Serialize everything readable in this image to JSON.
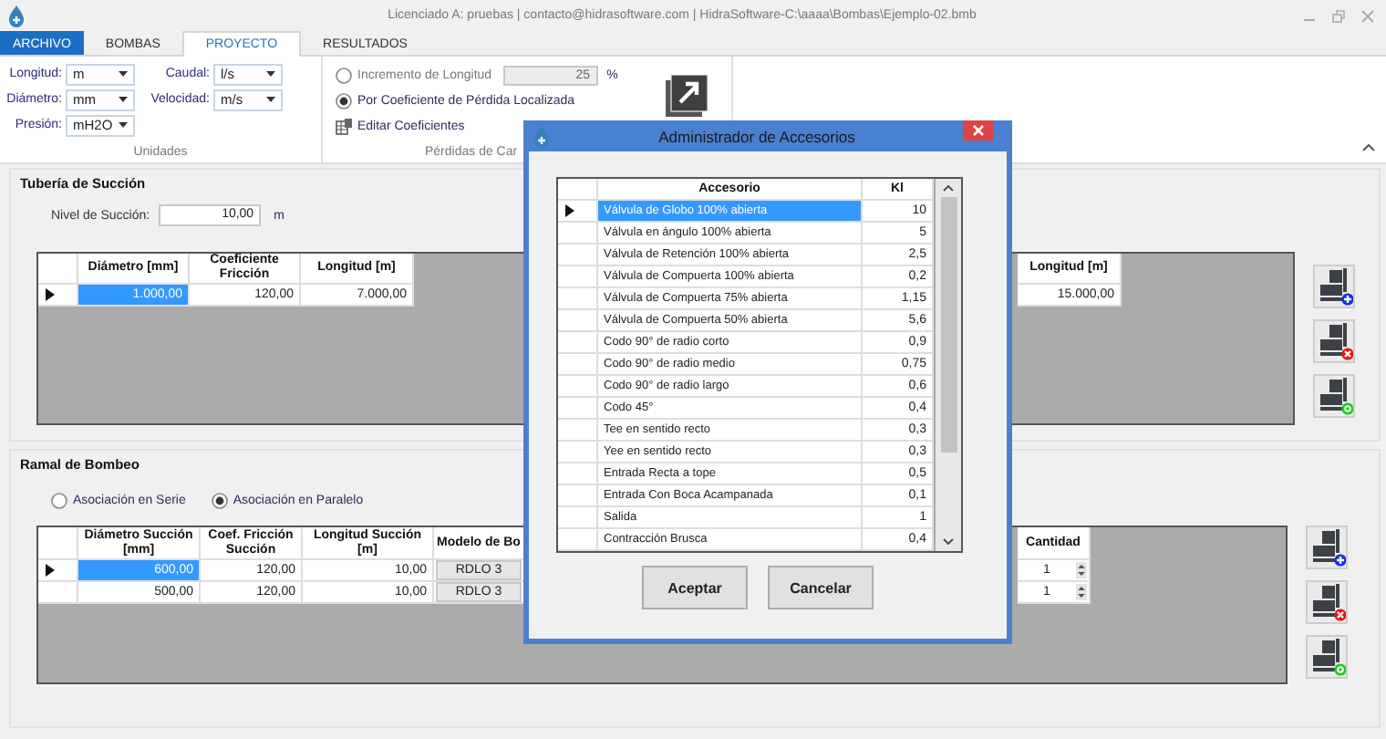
{
  "window": {
    "title": "Licenciado A: pruebas | contacto@hidrasoftware.com | HidraSoftware-C:\\aaaa\\Bombas\\Ejemplo-02.bmb"
  },
  "tabs": [
    {
      "label": "ARCHIVO",
      "kind": "file",
      "selected": false
    },
    {
      "label": "BOMBAS",
      "kind": "tab",
      "selected": false
    },
    {
      "label": "PROYECTO",
      "kind": "tab",
      "selected": true
    },
    {
      "label": "RESULTADOS",
      "kind": "tab",
      "selected": false
    }
  ],
  "units": {
    "label": "Unidades",
    "columns": [
      {
        "fields": [
          {
            "label": "Longitud:",
            "value": "m"
          },
          {
            "label": "Diámetro:",
            "value": "mm"
          },
          {
            "label": "Presión:",
            "value": "mH2O"
          }
        ]
      },
      {
        "fields": [
          {
            "label": "Caudal:",
            "value": "l/s"
          },
          {
            "label": "Velocidad:",
            "value": "m/s"
          }
        ]
      }
    ]
  },
  "losses": {
    "label": "Pérdidas de Car",
    "options": [
      {
        "label": "Incremento de Longitud",
        "selected": false,
        "disabled": true,
        "value": "25",
        "unit": "%"
      },
      {
        "label": "Por Coeficiente de Pérdida Localizada",
        "selected": true,
        "disabled": false
      }
    ],
    "link": "Editar Coeficientes"
  },
  "suction": {
    "title": "Tubería de Succión",
    "suction_level": {
      "label": "Nivel de Succión:",
      "value": "10,00",
      "unit": "m"
    },
    "columns": [
      "Diámetro [mm]",
      "Coeficiente Fricción",
      "Longitud [m]"
    ],
    "rows": [
      {
        "selected": true,
        "cells": [
          "1.000,00",
          "120,00",
          "7.000,00"
        ],
        "end_cell": "15.000,00"
      }
    ],
    "end_column": "Longitud [m]"
  },
  "pump_branch": {
    "title": "Ramal de Bombeo",
    "association": [
      {
        "label": "Asociación en Serie",
        "selected": false
      },
      {
        "label": "Asociación en Paralelo",
        "selected": true
      }
    ],
    "columns": [
      "Diámetro Succión [mm]",
      "Coef. Fricción Succión",
      "Longitud Succión [m]",
      "Modelo de Bo"
    ],
    "rows": [
      {
        "selected": true,
        "cells": [
          "600,00",
          "120,00",
          "10,00"
        ],
        "model": "RDLO 3",
        "quantity": "1"
      },
      {
        "selected": false,
        "cells": [
          "500,00",
          "120,00",
          "10,00"
        ],
        "model": "RDLO 3",
        "quantity": "1"
      }
    ],
    "end_column": "Cantidad"
  },
  "dialog": {
    "title": "Administrador de Accesorios",
    "columns": [
      "Accesorio",
      "Kl"
    ],
    "rows": [
      {
        "name": "Válvula de Globo 100% abierta",
        "kl": "10",
        "selected": true
      },
      {
        "name": "Válvula en ángulo 100% abierta",
        "kl": "5",
        "selected": false
      },
      {
        "name": "Válvula de Retención 100% abierta",
        "kl": "2,5",
        "selected": false
      },
      {
        "name": "Válvula de Compuerta 100% abierta",
        "kl": "0,2",
        "selected": false
      },
      {
        "name": "Válvula de Compuerta 75% abierta",
        "kl": "1,15",
        "selected": false
      },
      {
        "name": "Válvula de Compuerta 50% abierta",
        "kl": "5,6",
        "selected": false
      },
      {
        "name": "Codo 90° de radio corto",
        "kl": "0,9",
        "selected": false
      },
      {
        "name": "Codo 90° de radio medio",
        "kl": "0,75",
        "selected": false
      },
      {
        "name": "Codo 90° de radio largo",
        "kl": "0,6",
        "selected": false
      },
      {
        "name": "Codo 45°",
        "kl": "0,4",
        "selected": false
      },
      {
        "name": "Tee en sentido recto",
        "kl": "0,3",
        "selected": false
      },
      {
        "name": "Yee en sentido recto",
        "kl": "0,3",
        "selected": false
      },
      {
        "name": "Entrada Recta a tope",
        "kl": "0,5",
        "selected": false
      },
      {
        "name": "Entrada Con Boca Acampanada",
        "kl": "0,1",
        "selected": false
      },
      {
        "name": "Salida",
        "kl": "1",
        "selected": false
      },
      {
        "name": "Contracción Brusca",
        "kl": "0,4",
        "selected": false
      }
    ],
    "buttons": [
      "Aceptar",
      "Cancelar"
    ]
  }
}
